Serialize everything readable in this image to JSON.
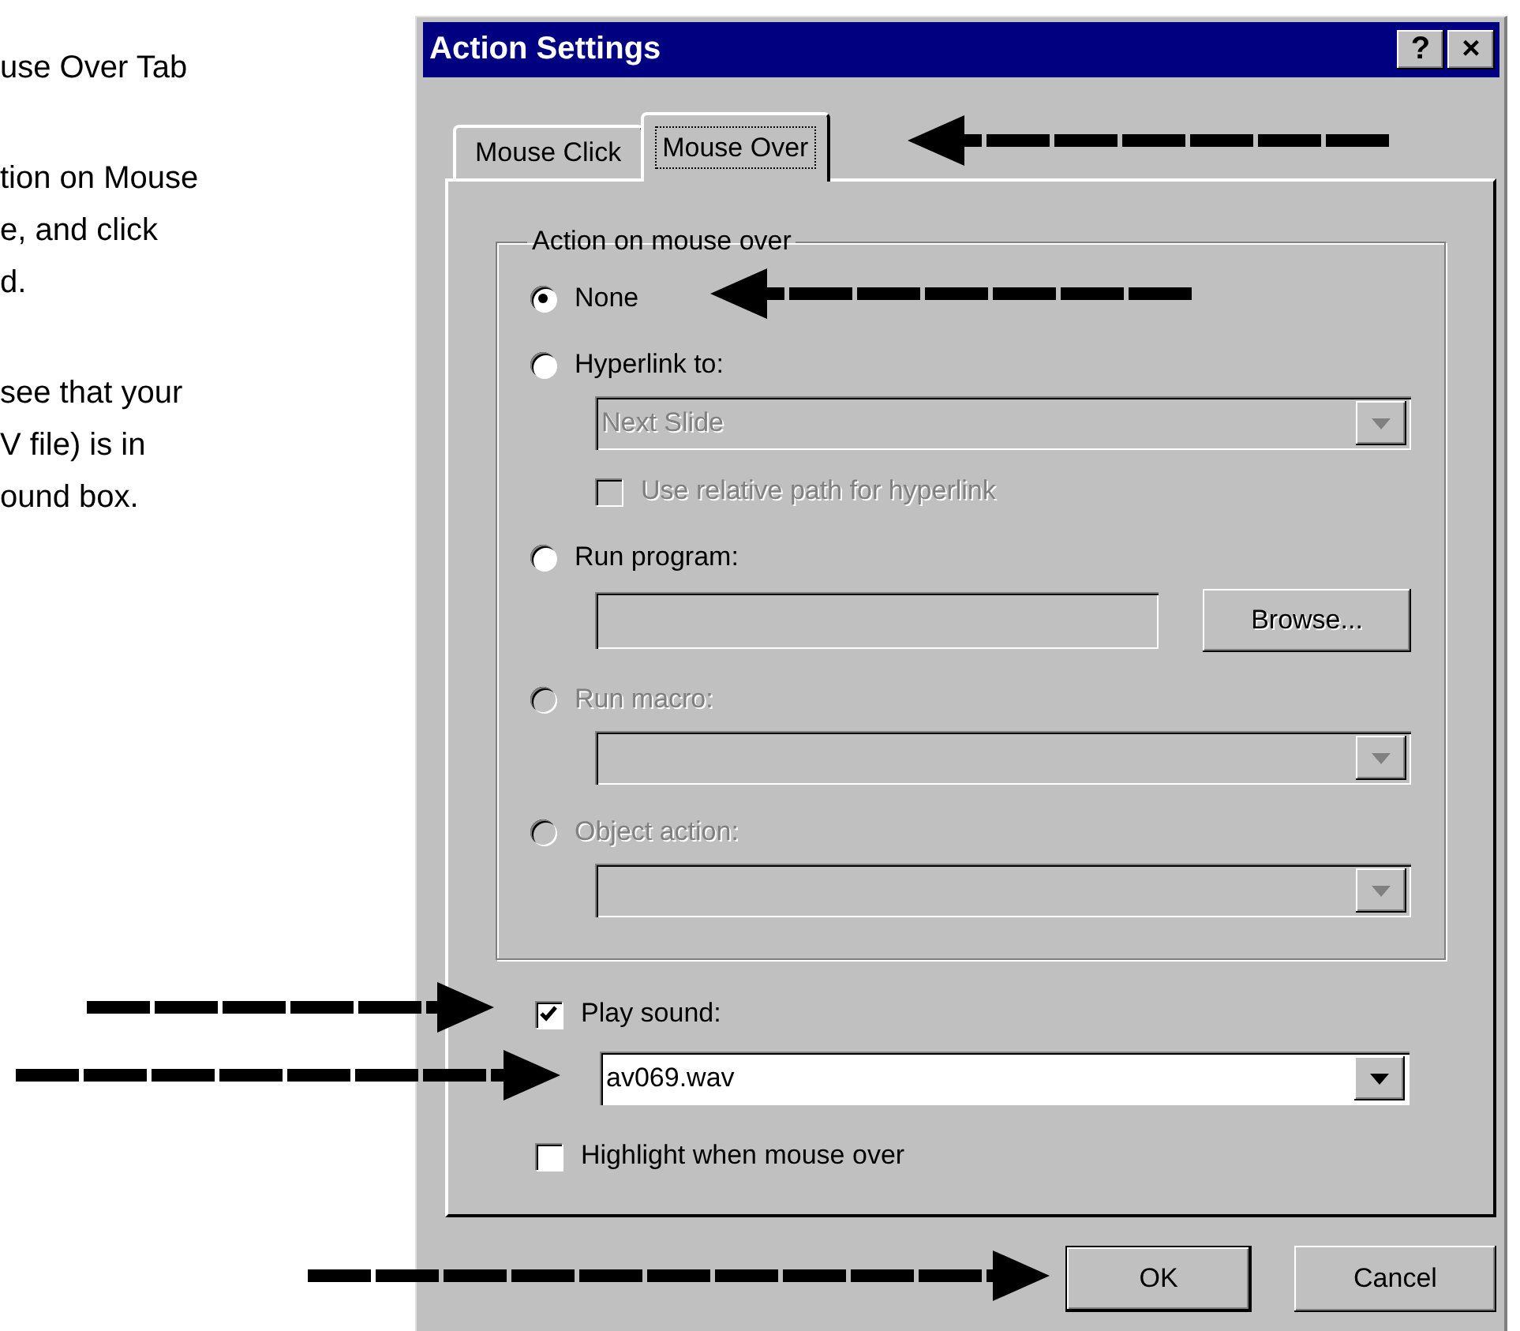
{
  "instructions": [
    [
      "use Over Tab"
    ],
    [
      "tion on Mouse",
      "e, and click",
      "d."
    ],
    [
      "see that your",
      "V file) is in",
      "ound box."
    ]
  ],
  "dialog": {
    "title": "Action Settings",
    "title_buttons": [
      "?",
      "×"
    ],
    "tabs": [
      {
        "label": "Mouse Click",
        "selected": false
      },
      {
        "label": "Mouse Over",
        "selected": true
      }
    ],
    "group": {
      "title": "Action on mouse over",
      "options": [
        {
          "kind": "radio",
          "label": "None",
          "selected": true,
          "disabled": false
        },
        {
          "kind": "radio",
          "label": "Hyperlink to:",
          "selected": false,
          "disabled": false,
          "children": [
            {
              "kind": "dropdown",
              "value": "Next Slide",
              "disabled": true
            },
            {
              "kind": "checkbox",
              "label": "Use relative path for hyperlink",
              "checked": false,
              "disabled": true
            }
          ]
        },
        {
          "kind": "radio",
          "label": "Run program:",
          "selected": false,
          "disabled": false,
          "children": [
            {
              "kind": "textbrowse",
              "button": "Browse...",
              "disabled": true
            }
          ]
        },
        {
          "kind": "radio",
          "label": "Run macro:",
          "selected": false,
          "disabled": true,
          "children": [
            {
              "kind": "dropdown",
              "disabled": true
            }
          ]
        },
        {
          "kind": "radio",
          "label": "Object action:",
          "selected": false,
          "disabled": true,
          "children": [
            {
              "kind": "dropdown",
              "disabled": true
            }
          ]
        }
      ]
    },
    "controls": [
      {
        "kind": "checkbox",
        "label": "Play sound:",
        "checked": true,
        "disabled": false
      },
      {
        "kind": "dropdown",
        "value": "av069.wav",
        "disabled": false
      },
      {
        "kind": "checkbox",
        "label": "Highlight when mouse over",
        "checked": false,
        "disabled": false
      }
    ],
    "buttons": [
      {
        "label": "OK",
        "default": true
      },
      {
        "label": "Cancel",
        "default": false
      }
    ]
  }
}
